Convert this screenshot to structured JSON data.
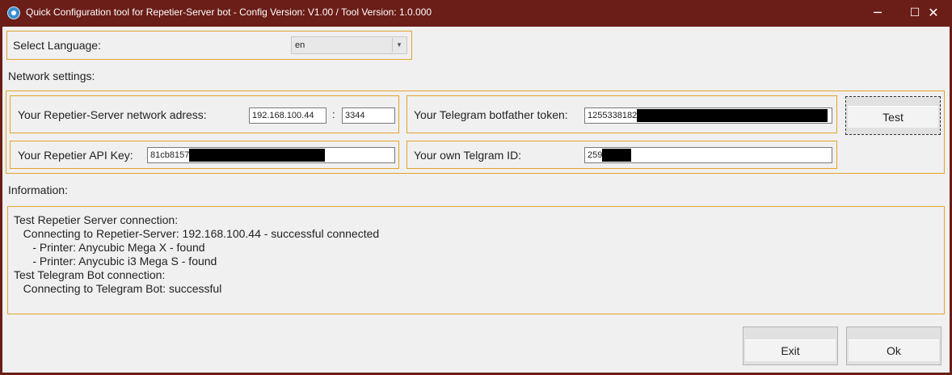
{
  "window": {
    "title": "Quick Configuration tool for Repetier-Server bot - Config Version: V1.00 / Tool Version: 1.0.000",
    "minimize_glyph": "─",
    "maximize_glyph": "☐",
    "close_glyph": "✕",
    "app_icon": "app-icon"
  },
  "language": {
    "label": "Select Language:",
    "value": "en",
    "arrow_glyph": "▼"
  },
  "network": {
    "section_label": "Network settings:",
    "server_address_label": "Your Repetier-Server network adress:",
    "server_address_value": "192.168.100.44",
    "port_separator": ":",
    "port_value": "3344",
    "api_key_label": "Your Repetier API Key:",
    "api_key_value": "81cb8157",
    "telegram_token_label": "Your Telegram botfather token:",
    "telegram_token_value": "1255338182",
    "telegram_id_label": "Your own Telgram ID:",
    "telegram_id_value": "259",
    "test_button": "Test"
  },
  "information": {
    "section_label": "Information:",
    "lines": [
      "Test Repetier Server connection:",
      "   Connecting to Repetier-Server: 192.168.100.44 - successful connected",
      "      - Printer: Anycubic Mega X - found",
      "      - Printer: Anycubic i3 Mega S - found",
      "Test Telegram Bot connection:",
      "   Connecting to Telegram Bot: successful"
    ]
  },
  "footer": {
    "exit_button": "Exit",
    "ok_button": "Ok"
  },
  "colors": {
    "titlebar": "#6b1d17",
    "frame_border": "#e2a42a",
    "client_bg": "#f0f0f0"
  }
}
